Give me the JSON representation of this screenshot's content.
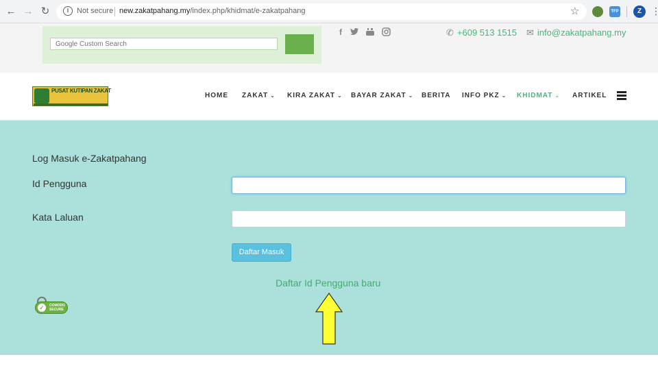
{
  "browser": {
    "security_label": "Not secure",
    "url_domain": "new.zakatpahang.my",
    "url_path": "/index.php/khidmat/e-zakatpahang",
    "info_icon": "info-icon",
    "back_icon": "back-arrow-icon",
    "forward_icon": "forward-arrow-icon",
    "reload_icon": "reload-icon",
    "bookmark_icon": "star-icon",
    "ext2_label": "TFP",
    "profile_initial": "Z"
  },
  "topbar": {
    "search_placeholder": "Google Custom Search",
    "social_icons": [
      "facebook-icon",
      "twitter-icon",
      "youtube-icon",
      "instagram-icon"
    ],
    "phone": "+609 513 1515",
    "email": "info@zakatpahang.my"
  },
  "header": {
    "logo_text": "PUSAT KUTIPAN ZAKAT",
    "nav": [
      {
        "label": "HOME",
        "dropdown": false
      },
      {
        "label": "ZAKAT",
        "dropdown": true
      },
      {
        "label": "KIRA ZAKAT",
        "dropdown": true
      },
      {
        "label": "BAYAR ZAKAT",
        "dropdown": true
      },
      {
        "label": "BERITA",
        "dropdown": false
      },
      {
        "label": "INFO PKZ",
        "dropdown": true
      },
      {
        "label": "KHIDMAT",
        "dropdown": true,
        "active": true
      },
      {
        "label": "ARTIKEL",
        "dropdown": false
      }
    ]
  },
  "form": {
    "title": "Log Masuk e-Zakatpahang",
    "username_label": "Id Pengguna",
    "username_value": "",
    "password_label": "Kata Laluan",
    "password_value": "",
    "login_button": "Daftar Masuk",
    "register_link": "Daftar Id Pengguna baru",
    "badge_text_1": "COMODO",
    "badge_text_2": "SECURE"
  },
  "colors": {
    "accent": "#43b87a",
    "main_bg": "#abe1da",
    "button": "#5bc0de",
    "annotation_arrow": "#ffff33"
  }
}
